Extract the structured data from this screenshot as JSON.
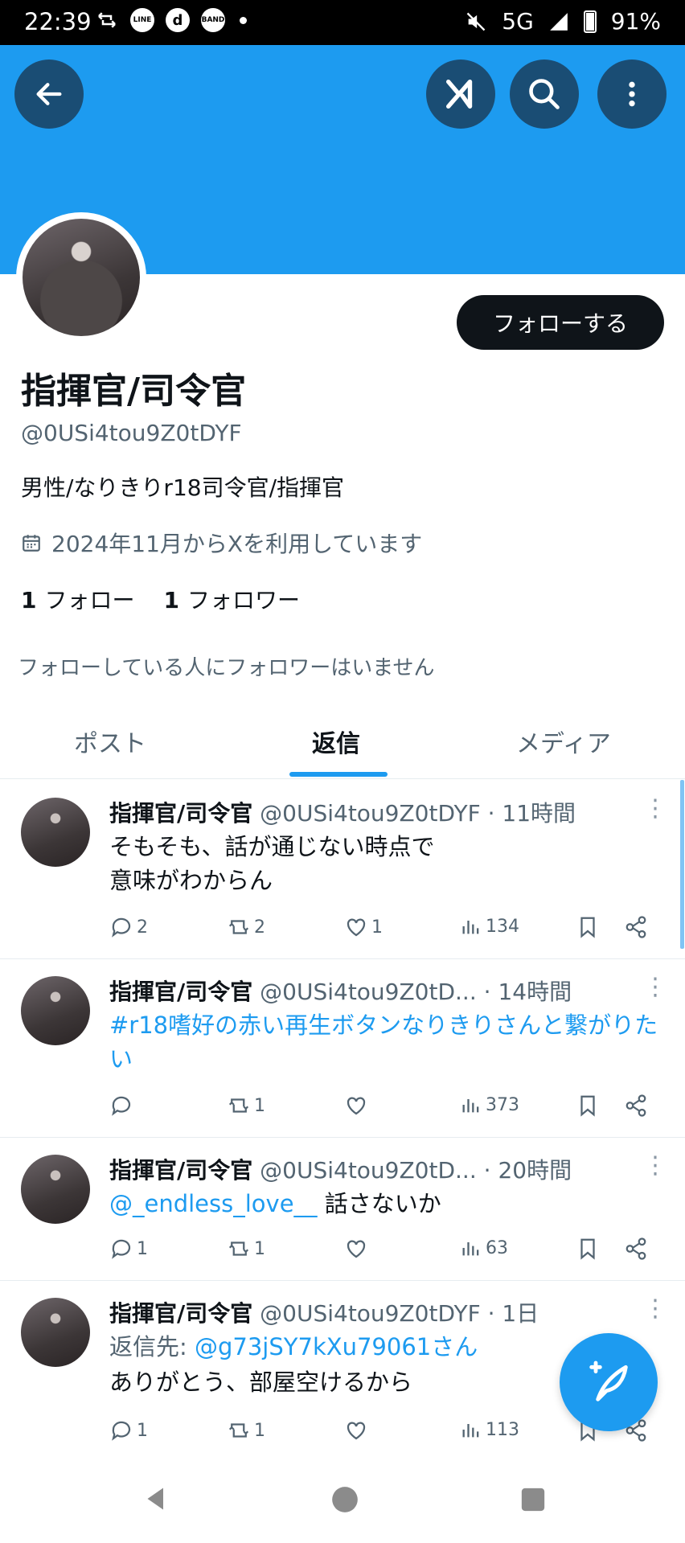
{
  "status_bar": {
    "time": "22:39",
    "network": "5G",
    "battery": "91%",
    "app_icons": [
      "repost",
      "LINE",
      "d",
      "BAND"
    ]
  },
  "top_bar": {
    "back_icon": "arrow-left-icon",
    "grok_icon": "grok-icon",
    "search_icon": "search-icon",
    "more_icon": "more-vertical-icon"
  },
  "profile": {
    "name": "指揮官/司令官",
    "handle": "@0USi4tou9Z0tDYF",
    "bio": "男性/なりきりr18司令官/指揮官",
    "joined": "2024年11月からXを利用しています",
    "following_count": "1",
    "following_label": "フォロー",
    "followers_count": "1",
    "followers_label": "フォロワー",
    "follow_button": "フォローする",
    "mutual_notice": "フォローしている人にフォロワーはいません"
  },
  "tabs": [
    {
      "label": "ポスト",
      "active": false
    },
    {
      "label": "返信",
      "active": true
    },
    {
      "label": "メディア",
      "active": false
    }
  ],
  "posts": [
    {
      "name": "指揮官/司令官",
      "handle": "@0USi4tou9Z0tDYF",
      "time": "· 11時間",
      "lines": [
        "そもそも、話が通じない時点で",
        "意味がわからん"
      ],
      "replies": "2",
      "reposts": "2",
      "likes": "1",
      "views": "134"
    },
    {
      "name": "指揮官/司令官",
      "handle": "@0USi4tou9Z0tD...",
      "time": "· 14時間",
      "hashtag_text": "#r18嗜好の赤い再生ボタンなりきりさんと繋がりたい",
      "replies": "",
      "reposts": "1",
      "likes": "",
      "views": "373"
    },
    {
      "name": "指揮官/司令官",
      "handle": "@0USi4tou9Z0tD...",
      "time": "· 20時間",
      "mention": "@_endless_love__",
      "text": " 話さないか",
      "replies": "1",
      "reposts": "1",
      "likes": "",
      "views": "63"
    },
    {
      "name": "指揮官/司令官",
      "handle": "@0USi4tou9Z0tDYF",
      "time": "· 1日",
      "reply_to_label": "返信先: ",
      "reply_to": "@g73jSY7kXu79061さん",
      "text": "ありがとう、部屋空けるから",
      "replies": "1",
      "reposts": "1",
      "likes": "",
      "views": "113"
    }
  ],
  "colors": {
    "accent": "#1d9bf0",
    "banner": "#1d9bf0",
    "text": "#0f1419",
    "muted": "#536471"
  },
  "fab": {
    "icon": "compose-post-icon"
  },
  "nav": {
    "back": "nav-back-icon",
    "home": "nav-home-icon",
    "recents": "nav-recents-icon"
  }
}
